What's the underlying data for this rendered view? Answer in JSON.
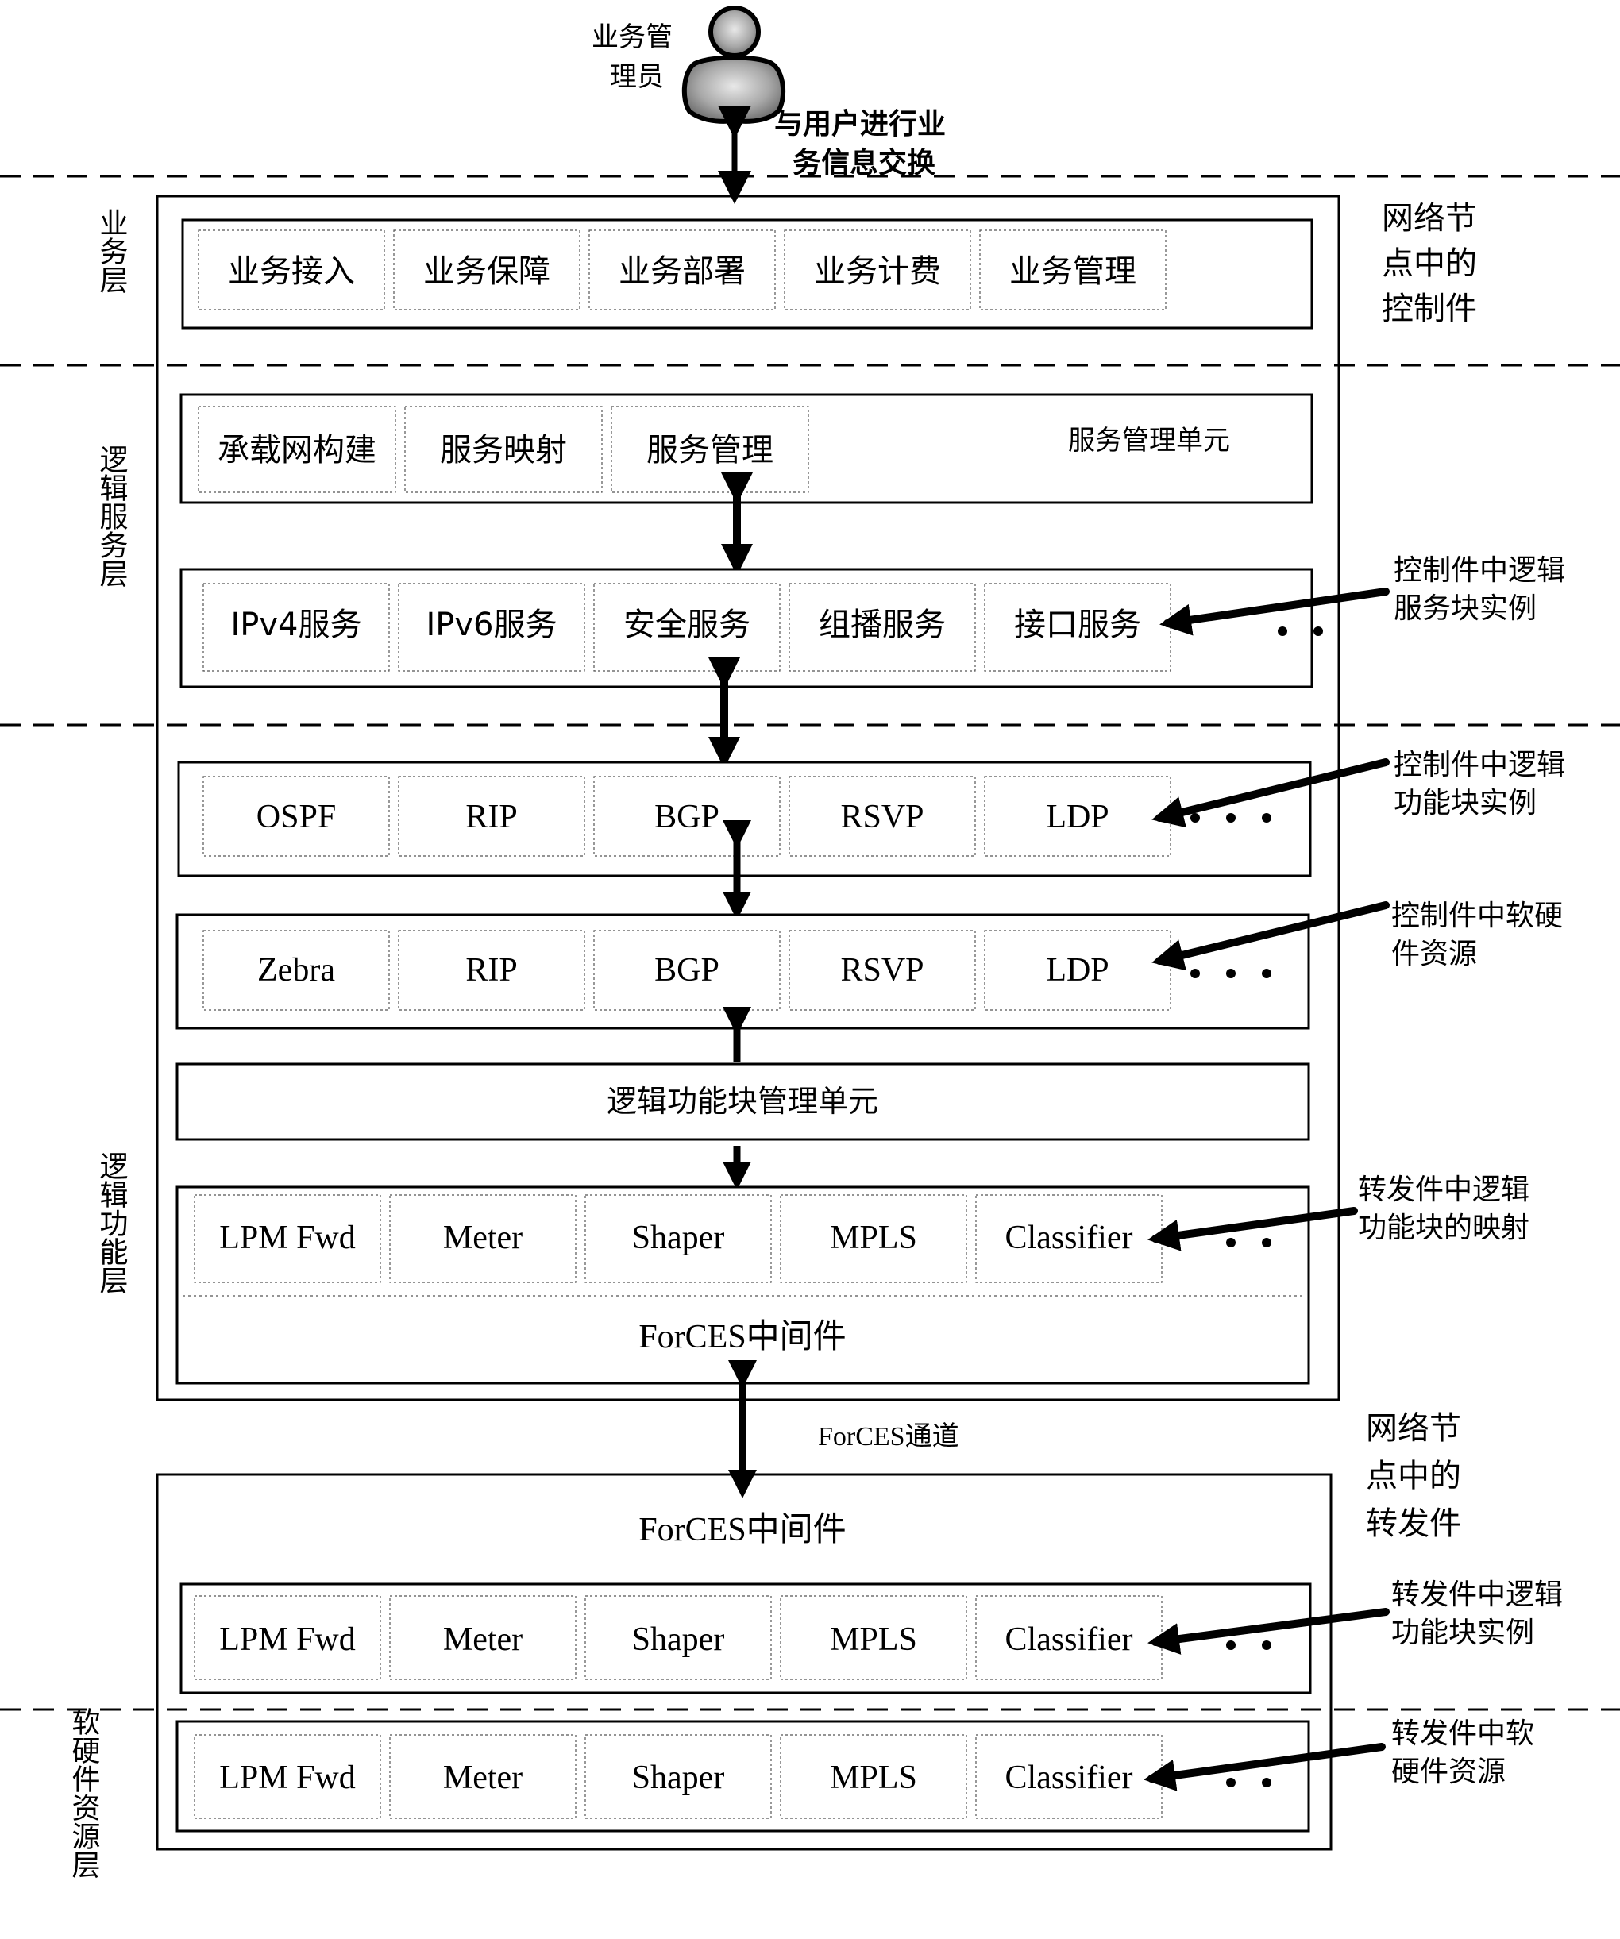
{
  "actor": {
    "label_line1": "业务管",
    "label_line2": "理员",
    "icon": "user-icon"
  },
  "exchange_label": {
    "line1": "与用户进行业",
    "line2": "务信息交换"
  },
  "layers": [
    {
      "id": "business",
      "label": "业务层"
    },
    {
      "id": "logic-service",
      "label": "逻辑服务层"
    },
    {
      "id": "logic-function",
      "label": "逻辑功能层"
    },
    {
      "id": "resource",
      "label": "软硬件资源层"
    }
  ],
  "control_element_label": {
    "line1": "网络节",
    "line2": "点中的",
    "line3": "控制件"
  },
  "forwarding_element_label": {
    "line1": "网络节",
    "line2": "点中的",
    "line3": "转发件"
  },
  "business_row": {
    "items": [
      "业务接入",
      "业务保障",
      "业务部署",
      "业务计费",
      "业务管理"
    ]
  },
  "service_mgmt_unit": {
    "title": "服务管理单元",
    "items": [
      "承载网构建",
      "服务映射",
      "服务管理"
    ]
  },
  "service_row": {
    "items": [
      "IPv4服务",
      "IPv6服务",
      "安全服务",
      "组播服务",
      "接口服务"
    ],
    "ellipsis": "• •"
  },
  "function_row": {
    "items": [
      "OSPF",
      "RIP",
      "BGP",
      "RSVP",
      "LDP"
    ],
    "ellipsis": "• • •"
  },
  "ce_resource_row": {
    "items": [
      "Zebra",
      "RIP",
      "BGP",
      "RSVP",
      "LDP"
    ],
    "ellipsis": "• • •"
  },
  "lfb_mgmt_unit": {
    "title": "逻辑功能块管理单元"
  },
  "ce_mapping_row": {
    "items": [
      "LPM Fwd",
      "Meter",
      "Shaper",
      "MPLS",
      "Classifier"
    ],
    "ellipsis": "• •",
    "middleware": "ForCES中间件"
  },
  "forces_channel": {
    "label": "ForCES通道"
  },
  "fe_middleware": {
    "title": "ForCES中间件"
  },
  "fe_lfb_row": {
    "items": [
      "LPM Fwd",
      "Meter",
      "Shaper",
      "MPLS",
      "Classifier"
    ],
    "ellipsis": "• •"
  },
  "fe_resource_row": {
    "items": [
      "LPM Fwd",
      "Meter",
      "Shaper",
      "MPLS",
      "Classifier"
    ],
    "ellipsis": "• •"
  },
  "annotations": [
    {
      "line1": "控制件中逻辑",
      "line2": "服务块实例"
    },
    {
      "line1": "控制件中逻辑",
      "line2": "功能块实例"
    },
    {
      "line1": "控制件中软硬",
      "line2": "件资源"
    },
    {
      "line1": "转发件中逻辑",
      "line2": "功能块的映射"
    },
    {
      "line1": "转发件中逻辑",
      "line2": "功能块实例"
    },
    {
      "line1": "转发件中软",
      "line2": "硬件资源"
    }
  ]
}
